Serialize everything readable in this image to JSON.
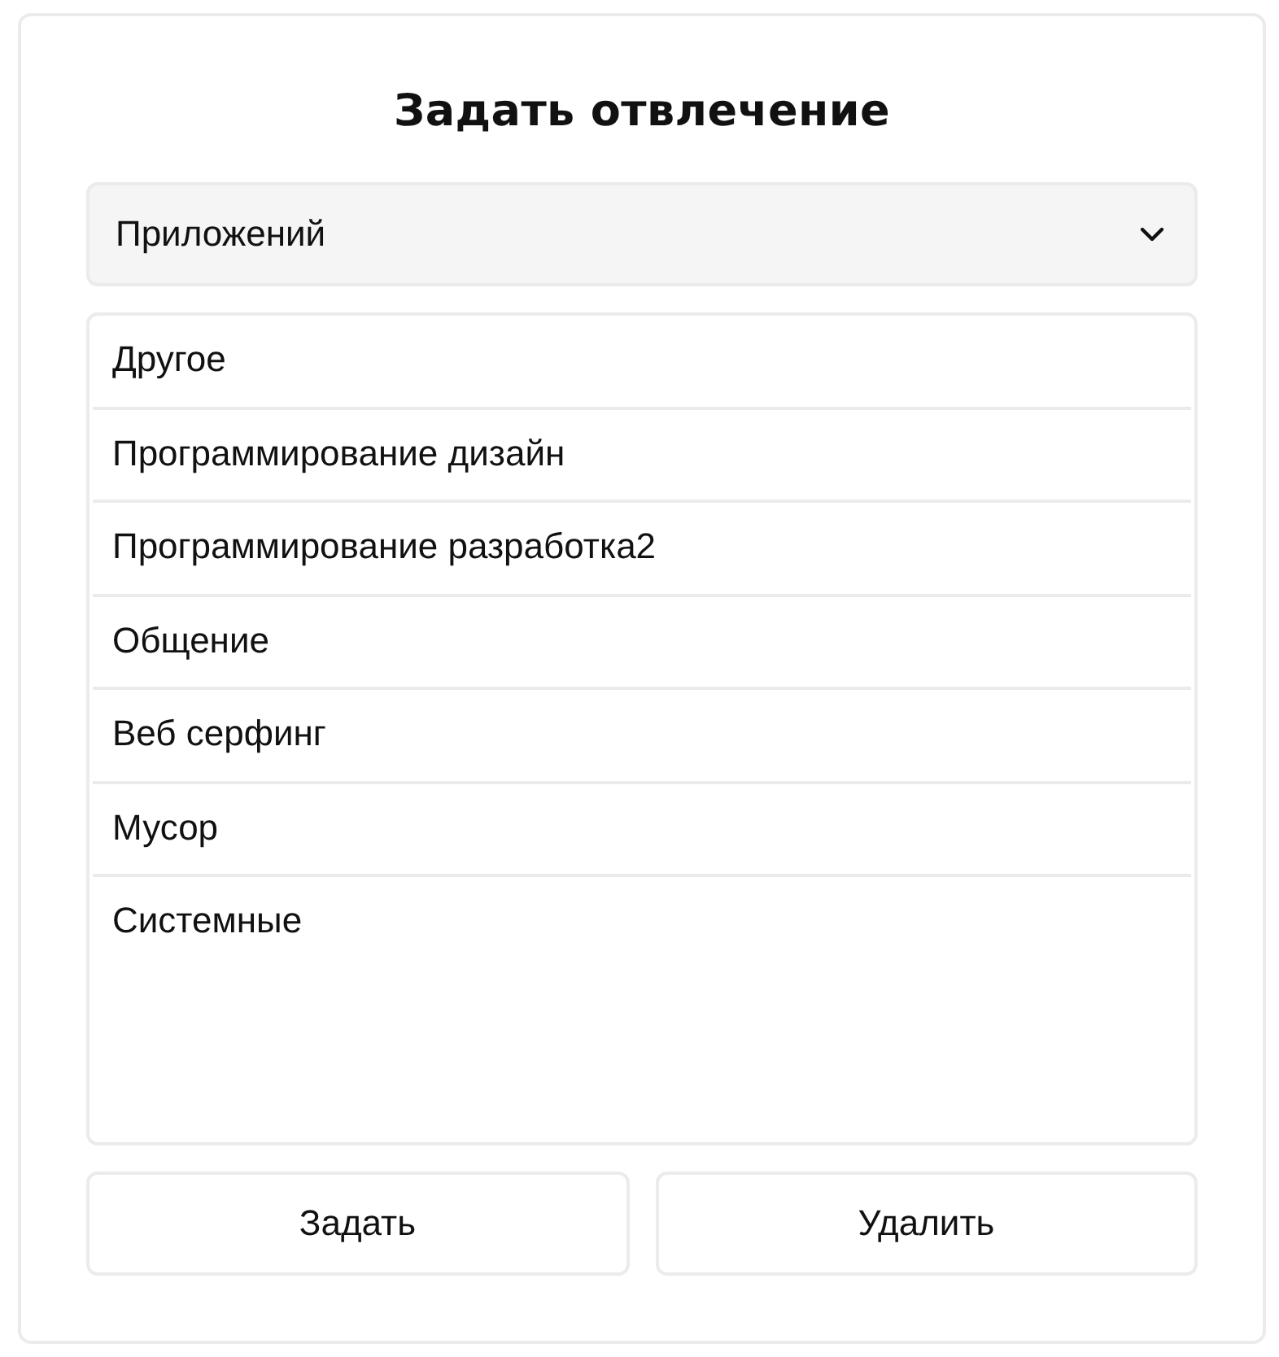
{
  "dialog": {
    "title": "Задать отвлечение"
  },
  "dropdown": {
    "value": "Приложений"
  },
  "list": {
    "items": [
      {
        "label": "Другое"
      },
      {
        "label": "Программирование дизайн"
      },
      {
        "label": "Программирование разработка2"
      },
      {
        "label": "Общение"
      },
      {
        "label": "Веб серфинг"
      },
      {
        "label": "Мусор"
      },
      {
        "label": "Системные"
      }
    ]
  },
  "buttons": [
    {
      "label": "Задать"
    },
    {
      "label": "Удалить"
    }
  ]
}
